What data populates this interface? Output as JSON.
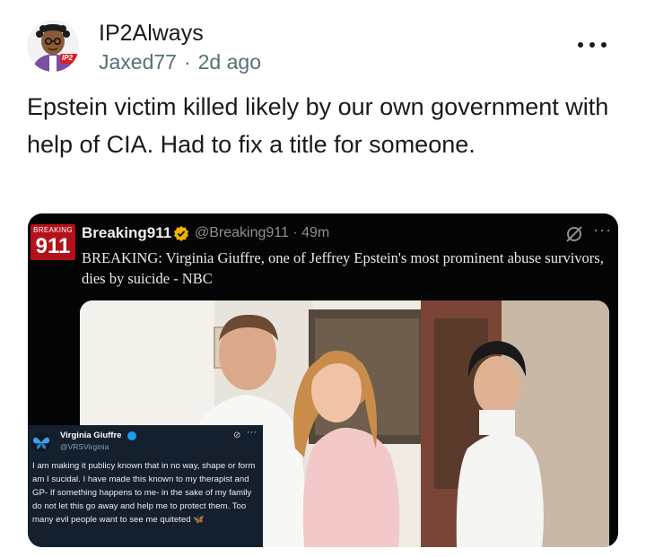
{
  "post": {
    "community": "IP2Always",
    "author": "Jaxed77",
    "separator": "·",
    "timestamp": "2d ago",
    "title": "Epstein victim killed likely by our own government with help of CIA. Had to fix a title for someone."
  },
  "avatar": {
    "badge_text": "IP2"
  },
  "tweet": {
    "logo_small": "BREAKING",
    "logo_big": "911",
    "name": "Breaking911",
    "handle_time": "@Breaking911 · 49m",
    "dots": "···",
    "body": "BREAKING: Virginia Giuffre, one of Jeffrey Epstein's most prominent abuse survivors, dies by suicide - NBC"
  },
  "inset_tweet": {
    "name": "Virginia Giuffre",
    "handle": "@VRSVirginia",
    "dots": "···",
    "body": "I am making it publicy known that in no way, shape or form am I sucidal. I have made this known to my therapist and GP- If something happens to me- in the sake of my family do not let this go away and help me to protect them. Too many evil people want to see me quiteted",
    "emoji": "🦋"
  },
  "colors": {
    "breaking_red": "#b3121b",
    "verified_gold": "#f4b400",
    "verified_blue": "#1d9bf0",
    "meta_gray": "#576f76"
  }
}
